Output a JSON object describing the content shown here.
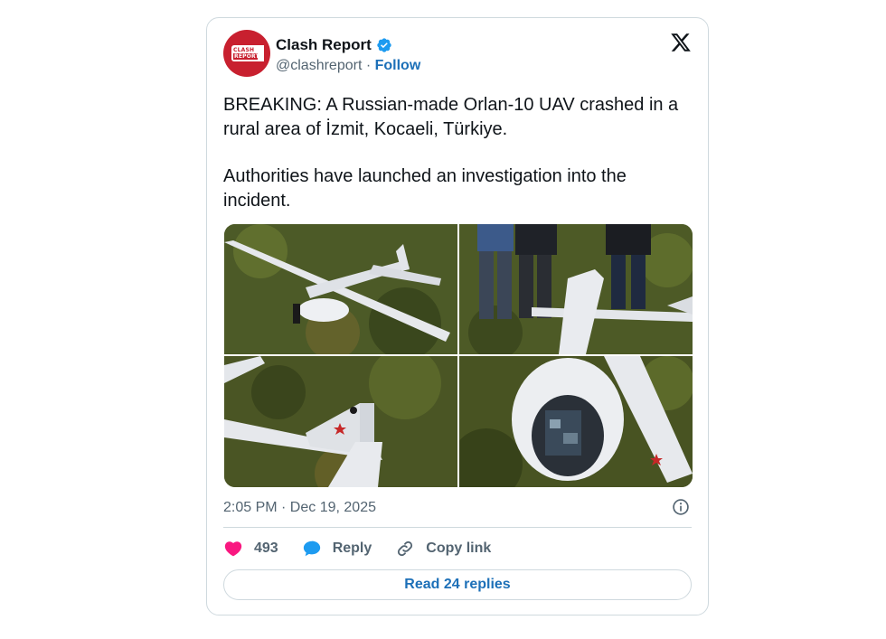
{
  "account": {
    "display_name": "Clash Report",
    "handle": "@clashreport",
    "separator": " · ",
    "follow_label": "Follow",
    "avatar_text_top": "CLASH",
    "avatar_text_bottom": "REPORT",
    "verified_icon": "verified-badge-icon",
    "avatar_color": "#c8202f"
  },
  "platform_icon": "x-logo-icon",
  "tweet": {
    "paragraph_1": "BREAKING: A Russian-made Orlan-10 UAV crashed in a rural area of İzmit, Kocaeli, Türkiye.",
    "paragraph_2": "Authorities have launched an investigation into the incident."
  },
  "media": {
    "photos": [
      {
        "icon": "photo-drone-on-grass"
      },
      {
        "icon": "photo-people-standing-by-drone"
      },
      {
        "icon": "photo-drone-tail-red-star"
      },
      {
        "icon": "photo-drone-nose-electronics"
      }
    ]
  },
  "meta": {
    "timestamp": "2:05 PM · Dec 19, 2025",
    "info_icon": "info-icon"
  },
  "actions": {
    "like_count": "493",
    "reply_label": "Reply",
    "copy_link_label": "Copy link",
    "like_color": "#f91880",
    "reply_color": "#1d9bf0"
  },
  "read_replies_label": "Read 24 replies",
  "link_color": "#1d70b8"
}
